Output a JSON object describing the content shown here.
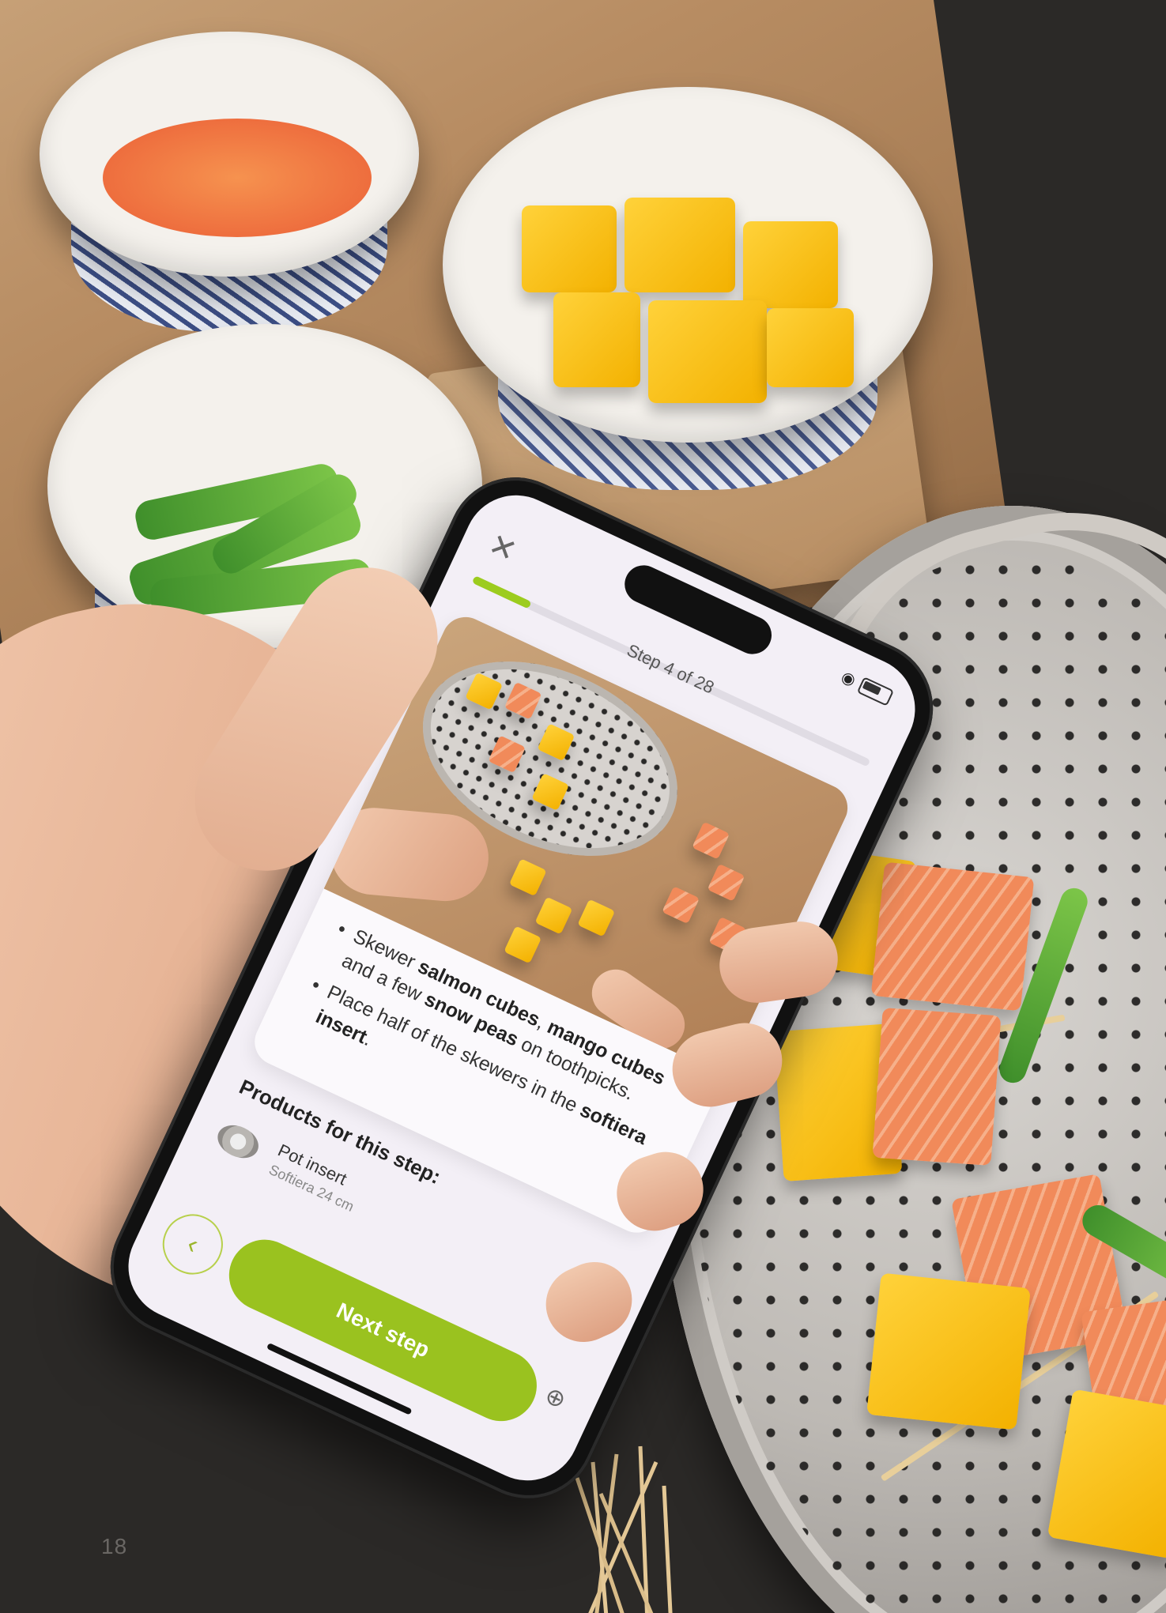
{
  "app": {
    "step_label": "Step 4 of 28",
    "progress": 0.143,
    "close_icon": "close-icon",
    "instructions": [
      {
        "parts": [
          {
            "text": "Skewer ",
            "bold": false
          },
          {
            "text": "salmon cubes",
            "bold": true
          },
          {
            "text": ", ",
            "bold": false
          },
          {
            "text": "mango cubes",
            "bold": true
          },
          {
            "text": " and a few ",
            "bold": false
          },
          {
            "text": "snow peas",
            "bold": true
          },
          {
            "text": " on toothpicks.",
            "bold": false
          }
        ]
      },
      {
        "parts": [
          {
            "text": "Place half of the skewers in the ",
            "bold": false
          },
          {
            "text": "softiera insert",
            "bold": true
          },
          {
            "text": ".",
            "bold": false
          }
        ]
      }
    ],
    "products_title": "Products for this step:",
    "products": [
      {
        "name": "Pot insert",
        "subtitle": "Softiera 24 cm"
      }
    ],
    "back_icon": "chevron-left-icon",
    "next_button": "Next step",
    "zoom_icon": "zoom-icon"
  },
  "page": {
    "number": "18"
  },
  "colors": {
    "accent_green": "#9ac21f",
    "progress_green": "#9ccc1e"
  }
}
